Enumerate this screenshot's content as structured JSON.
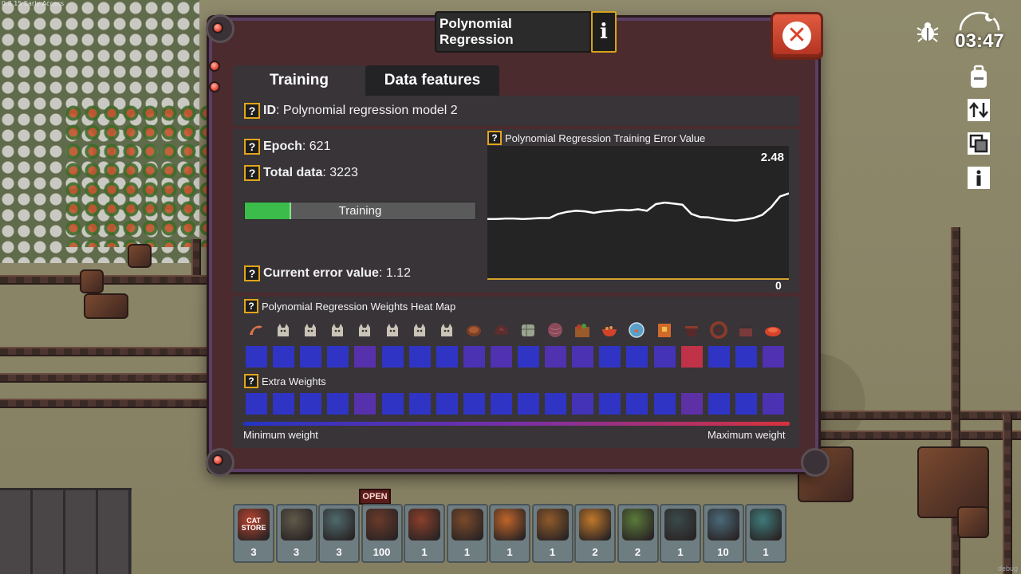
{
  "game": {
    "version": "0.8.15 Early Access",
    "debug_label": "debug"
  },
  "hud": {
    "time": "03:47",
    "icons": [
      "bug-icon",
      "day-night-icon",
      "backpack-icon",
      "sort-icon",
      "layers-icon",
      "info-icon"
    ]
  },
  "dialog": {
    "title": "Polynomial Regression",
    "info_glyph": "i",
    "close_glyph": "✕",
    "tabs": [
      {
        "label": "Training",
        "active": true
      },
      {
        "label": "Data features",
        "active": false
      }
    ],
    "help_glyph": "?",
    "id_label": "ID",
    "id_value": ": Polynomial regression model 2",
    "epoch_label": "Epoch",
    "epoch_value": ": 621",
    "total_label": "Total data",
    "total_value": ": 3223",
    "progress": {
      "label": "Training",
      "fraction": 0.2
    },
    "error_label": "Current error value",
    "error_value": ": 1.12",
    "chart_title": "Polynomial Regression Training Error Value",
    "heatmap_title": "Polynomial Regression Weights Heat Map",
    "extra_title": "Extra Weights",
    "min_weight": "Minimum weight",
    "max_weight": "Maximum weight",
    "feature_icons": [
      "shrimp-icon",
      "cat-icon",
      "cat-icon",
      "cat-icon",
      "cat-icon",
      "cat-icon",
      "cat-icon",
      "cat-icon",
      "wood-icon",
      "ore-icon",
      "stone-icon",
      "yarn-icon",
      "crate-icon",
      "food-bowl-icon",
      "fish-bowl-icon",
      "box-icon",
      "pot-icon",
      "coil-icon",
      "cake-icon",
      "dish-icon"
    ],
    "weights_row": [
      0.05,
      0.05,
      0.05,
      0.05,
      0.35,
      0.05,
      0.05,
      0.05,
      0.25,
      0.3,
      0.05,
      0.3,
      0.25,
      0.05,
      0.05,
      0.2,
      0.95,
      0.05,
      0.05,
      0.3
    ],
    "extra_row": [
      0.05,
      0.05,
      0.05,
      0.05,
      0.35,
      0.05,
      0.05,
      0.05,
      0.05,
      0.05,
      0.05,
      0.05,
      0.2,
      0.05,
      0.05,
      0.05,
      0.4,
      0.05,
      0.05,
      0.25
    ]
  },
  "chart_data": {
    "type": "line",
    "title": "Polynomial Regression Training Error Value",
    "xlabel": "",
    "ylabel": "",
    "ylim": [
      0,
      2.48
    ],
    "tick_labels": {
      "y_max": "2.48",
      "y_min": "0"
    },
    "grid": false,
    "series": [
      {
        "values": [
          1.12,
          1.12,
          1.13,
          1.13,
          1.12,
          1.13,
          1.14,
          1.14,
          1.22,
          1.26,
          1.28,
          1.27,
          1.24,
          1.27,
          1.28,
          1.3,
          1.29,
          1.31,
          1.28,
          1.41,
          1.44,
          1.42,
          1.4,
          1.22,
          1.16,
          1.15,
          1.12,
          1.1,
          1.09,
          1.11,
          1.14,
          1.2,
          1.35,
          1.56,
          1.62
        ]
      }
    ]
  },
  "hotbar": {
    "open_sign": "OPEN",
    "store_sign": "CAT STORE",
    "slots": [
      {
        "name": "cat-store",
        "count": "3",
        "color": "#b8432f"
      },
      {
        "name": "cat-house",
        "count": "3",
        "color": "#5f5a4a"
      },
      {
        "name": "robot-arm",
        "count": "3",
        "color": "#4f6a6e"
      },
      {
        "name": "conveyor-belt",
        "count": "100",
        "color": "#6a3a2a"
      },
      {
        "name": "furnace",
        "count": "1",
        "color": "#8a3f2a"
      },
      {
        "name": "assembler",
        "count": "1",
        "color": "#7a4a2a"
      },
      {
        "name": "drill",
        "count": "1",
        "color": "#c0652a"
      },
      {
        "name": "smelter",
        "count": "1",
        "color": "#8f5a2a"
      },
      {
        "name": "crafter",
        "count": "2",
        "color": "#c0782a"
      },
      {
        "name": "garden",
        "count": "2",
        "color": "#5a7a3a"
      },
      {
        "name": "generator",
        "count": "1",
        "color": "#3a4a4a"
      },
      {
        "name": "research-lab",
        "count": "10",
        "color": "#4a6a7a"
      },
      {
        "name": "turret",
        "count": "1",
        "color": "#3f7a7a"
      }
    ]
  },
  "colors": {
    "weight_min": "#2a35c8",
    "weight_mid": "#6a2f9e",
    "weight_max": "#c8323e",
    "progress": "#3cbc4a",
    "accent_border": "#e2a51b"
  }
}
